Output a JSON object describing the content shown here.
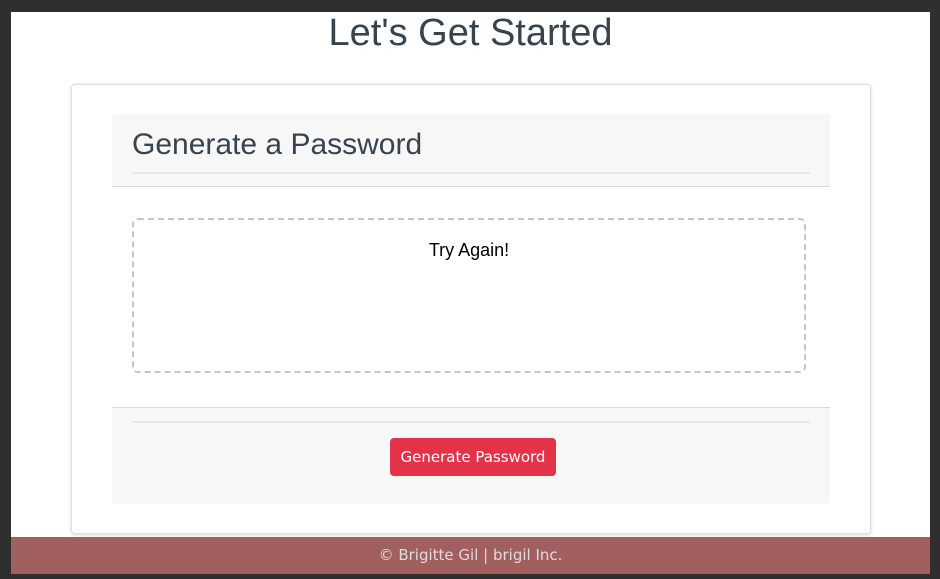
{
  "header": {
    "title": "Let's Get Started"
  },
  "card": {
    "title": "Generate a Password",
    "password_output": "Try Again!",
    "generate_button": "Generate Password"
  },
  "footer": {
    "text": "© Brigitte Gil | brigil Inc."
  },
  "colors": {
    "accent": "#e33349",
    "footer_bg": "#a25f5f",
    "heading": "#37434f"
  }
}
